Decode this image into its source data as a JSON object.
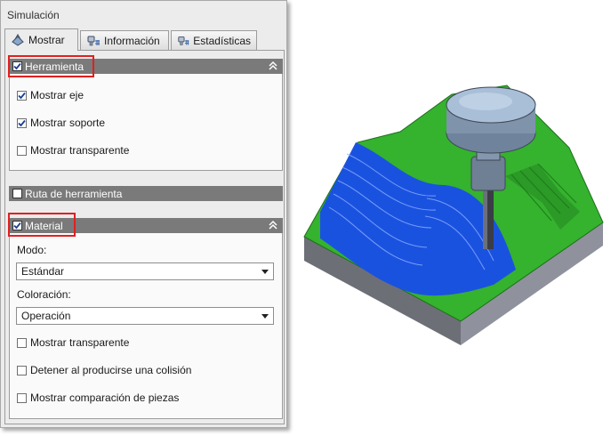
{
  "panel": {
    "title": "Simulación"
  },
  "tabs": [
    {
      "label": "Mostrar",
      "icon": "display-icon",
      "active": true
    },
    {
      "label": "Información",
      "icon": "info-icon",
      "active": false
    },
    {
      "label": "Estadísticas",
      "icon": "stats-icon",
      "active": false
    }
  ],
  "herramienta": {
    "label": "Herramienta",
    "checked": true,
    "options": [
      {
        "label": "Mostrar eje",
        "checked": true
      },
      {
        "label": "Mostrar soporte",
        "checked": true
      },
      {
        "label": "Mostrar transparente",
        "checked": false
      }
    ]
  },
  "ruta": {
    "label": "Ruta de herramienta",
    "checked": false
  },
  "material": {
    "label": "Material",
    "checked": true,
    "modo_label": "Modo:",
    "modo_value": "Estándar",
    "coloracion_label": "Coloración:",
    "coloracion_value": "Operación",
    "options": [
      {
        "label": "Mostrar transparente",
        "checked": false
      },
      {
        "label": "Detener al producirse una colisión",
        "checked": false
      },
      {
        "label": "Mostrar comparación de piezas",
        "checked": false
      }
    ]
  },
  "colors": {
    "highlight": "#e02020",
    "section_bar": "#7a7a7a",
    "part_green": "#33b52f",
    "cut_blue": "#1a52e0"
  }
}
